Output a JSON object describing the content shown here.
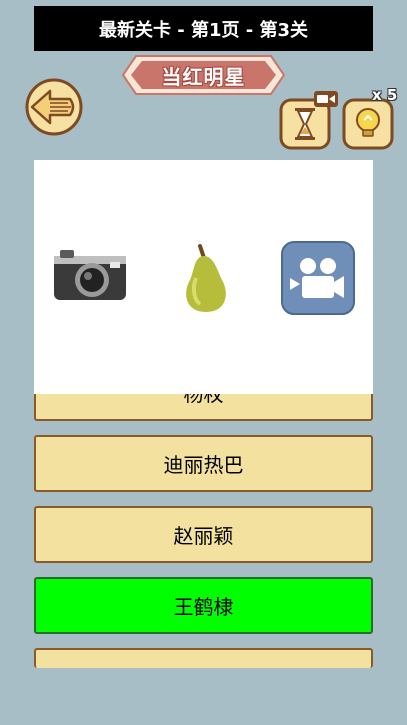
{
  "header": {
    "title": "最新关卡 - 第1页 - 第3关"
  },
  "banner": {
    "label": "当红明星"
  },
  "hint": {
    "count": "x 5"
  },
  "clues": [
    "camera",
    "pear",
    "video-camera"
  ],
  "options": [
    {
      "label": "杨枚",
      "state": "partially-hidden"
    },
    {
      "label": "迪丽热巴",
      "state": "normal"
    },
    {
      "label": "赵丽颖",
      "state": "normal"
    },
    {
      "label": "王鹤棣",
      "state": "selected"
    },
    {
      "label": "",
      "state": "cut-off"
    }
  ],
  "colors": {
    "background": "#a7bec6",
    "option_bg": "#f3e1a0",
    "selected_bg": "#00ff00",
    "banner": "#c9756b"
  }
}
